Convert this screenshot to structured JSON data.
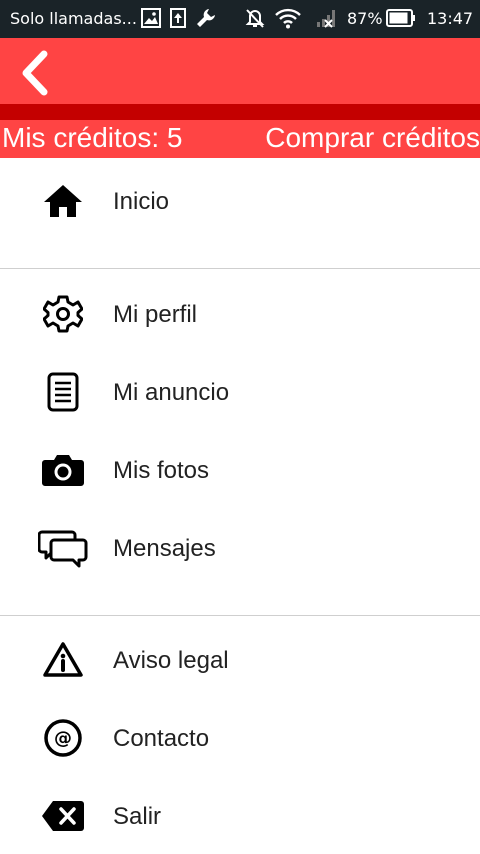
{
  "status_bar": {
    "carrier": "Solo llamadas...",
    "battery": "87%",
    "time": "13:47",
    "icons": [
      "image-icon",
      "upload-icon",
      "wrench-icon",
      "mute-icon",
      "wifi-icon",
      "no-signal-icon",
      "battery-icon"
    ]
  },
  "header": {
    "back_icon": "chevron-left-icon",
    "credits_label": "Mis créditos: 5",
    "buy_credits": "Comprar créditos",
    "colors": {
      "primary": "#ff4444",
      "stripe": "#c40000"
    }
  },
  "menu": {
    "inicio": {
      "label": "Inicio",
      "icon": "home-icon"
    },
    "mi_perfil": {
      "label": "Mi perfil",
      "icon": "gear-icon"
    },
    "mi_anuncio": {
      "label": "Mi anuncio",
      "icon": "document-icon"
    },
    "mis_fotos": {
      "label": "Mis fotos",
      "icon": "camera-icon"
    },
    "mensajes": {
      "label": "Mensajes",
      "icon": "chat-icon"
    },
    "aviso_legal": {
      "label": "Aviso legal",
      "icon": "info-icon"
    },
    "contacto": {
      "label": "Contacto",
      "icon": "at-icon"
    },
    "salir": {
      "label": "Salir",
      "icon": "backspace-icon"
    }
  }
}
